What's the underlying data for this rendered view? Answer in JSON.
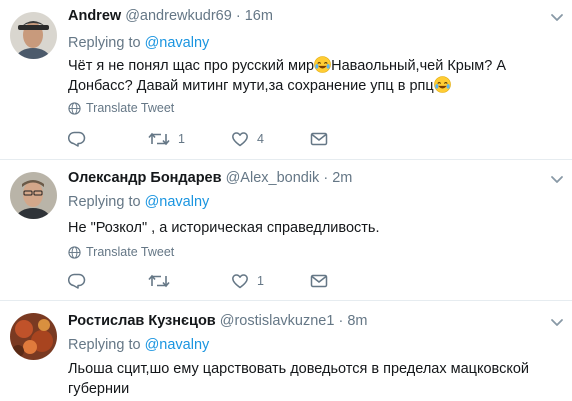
{
  "tweets": [
    {
      "name": "Andrew",
      "handle": "@andrewkudr69",
      "separator": "·",
      "time": "16m",
      "replying_prefix": "Replying to",
      "replying_to": "@navalny",
      "text_part1": "Чёт я не понял щас про русский мир",
      "text_part2": "Наваольный,чей Крым?  А Донбасс?  Давай митинг мути,за сохранение упц в рпц",
      "translate_label": "Translate Tweet",
      "retweets": "1",
      "likes": "4"
    },
    {
      "name": "Олександр Бондарев",
      "handle": "@Alex_bondik",
      "separator": "·",
      "time": "2m",
      "replying_prefix": "Replying to",
      "replying_to": "@navalny",
      "text": "Не \"Розкол\" , а историческая справедливость.",
      "translate_label": "Translate Tweet",
      "retweets": "",
      "likes": "1"
    },
    {
      "name": "Ростислав Кузнєцов",
      "handle": "@rostislavkuzne1",
      "separator": "·",
      "time": "8m",
      "replying_prefix": "Replying to",
      "replying_to": "@navalny",
      "text": "Льоша сцит,шо ему царствовать доведьотся в пределах мацковской губернии"
    }
  ],
  "colors": {
    "accent": "#1b95e0",
    "muted": "#657786",
    "text": "#14171a",
    "divider": "#e6ecf0"
  },
  "icons": [
    "reply-icon",
    "retweet-icon",
    "like-icon",
    "message-icon",
    "globe-icon",
    "chevron-down-icon",
    "tears-of-joy-emoji"
  ]
}
